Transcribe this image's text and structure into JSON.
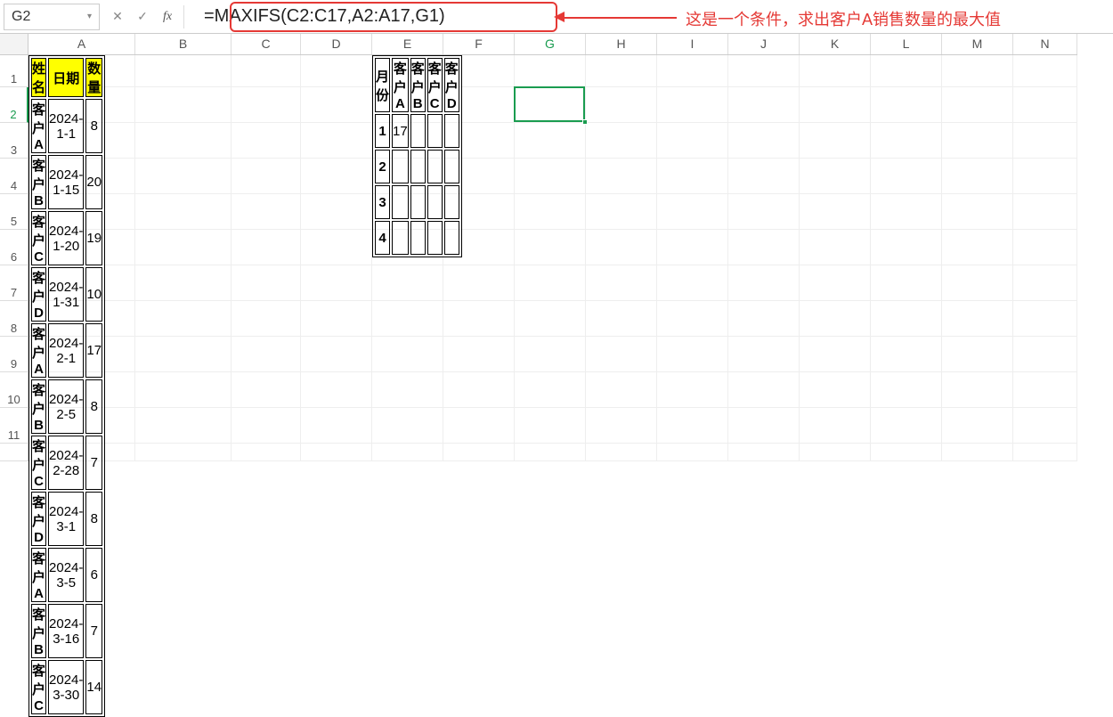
{
  "name_box": "G2",
  "formula": "=MAXIFS(C2:C17,A2:A17,G1)",
  "annotation": "这是一个条件，求出客户A销售数量的最大值",
  "columns": [
    "A",
    "B",
    "C",
    "D",
    "E",
    "F",
    "G",
    "H",
    "I",
    "J",
    "K",
    "L",
    "M",
    "N"
  ],
  "col_widths": [
    "cA",
    "cB",
    "cC",
    "cD",
    "cE",
    "cF",
    "cG",
    "cH",
    "cI",
    "cJ",
    "cK",
    "cL",
    "cM",
    "cN"
  ],
  "rows": [
    "1",
    "2",
    "3",
    "4",
    "5",
    "6",
    "7",
    "8",
    "9",
    "10",
    "11"
  ],
  "left_table": {
    "headers": [
      "姓名",
      "日期",
      "数量"
    ],
    "rows": [
      [
        "客户A",
        "2024-1-1",
        "8"
      ],
      [
        "客户B",
        "2024-1-15",
        "20"
      ],
      [
        "客户C",
        "2024-1-20",
        "19"
      ],
      [
        "客户D",
        "2024-1-31",
        "10"
      ],
      [
        "客户A",
        "2024-2-1",
        "17"
      ],
      [
        "客户B",
        "2024-2-5",
        "8"
      ],
      [
        "客户C",
        "2024-2-28",
        "7"
      ],
      [
        "客户D",
        "2024-3-1",
        "8"
      ],
      [
        "客户A",
        "2024-3-5",
        "6"
      ],
      [
        "客户B",
        "2024-3-16",
        "7"
      ],
      [
        "客户C",
        "2024-3-30",
        "14"
      ]
    ]
  },
  "right_table": {
    "headers": [
      "月份",
      "客户A",
      "客户B",
      "客户C",
      "客户D"
    ],
    "rows": [
      [
        "1",
        "17",
        "",
        "",
        ""
      ],
      [
        "2",
        "",
        "",
        "",
        ""
      ],
      [
        "3",
        "",
        "",
        "",
        ""
      ],
      [
        "4",
        "",
        "",
        "",
        ""
      ]
    ]
  },
  "active": {
    "col_index": 6,
    "row_index": 1
  },
  "fx_icons": {
    "cancel": "✕",
    "confirm": "✓",
    "fx": "fx",
    "dd": "▾"
  }
}
